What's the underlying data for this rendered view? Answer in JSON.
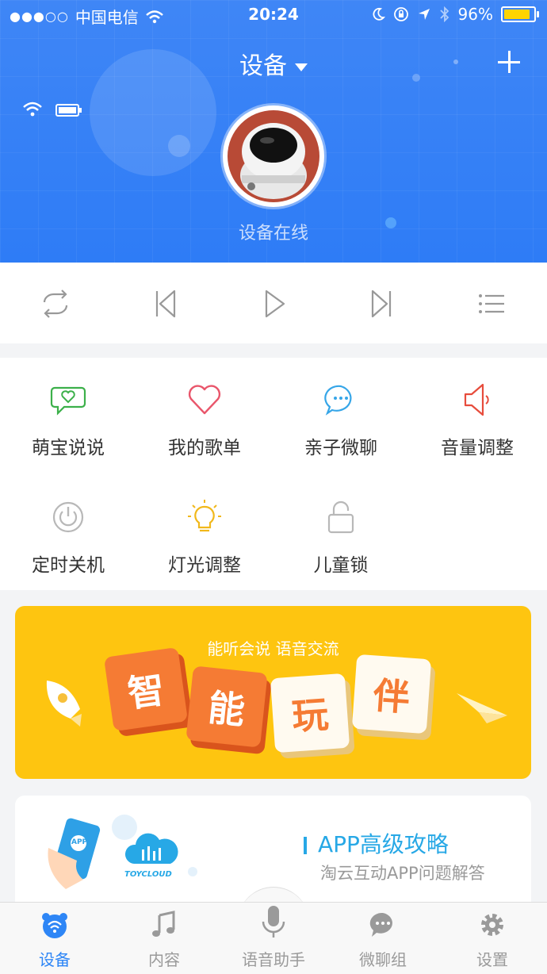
{
  "status_bar": {
    "signal_dots": "●●●○○",
    "carrier": "中国电信",
    "time": "20:24",
    "battery_percent": "96%",
    "battery_level": 0.96,
    "battery_color": "#ffd400"
  },
  "header": {
    "title": "设备",
    "status": "设备在线",
    "bg_color": "#2e7cf6"
  },
  "player": {
    "buttons": [
      "repeat-icon",
      "previous-icon",
      "play-icon",
      "next-icon",
      "playlist-icon"
    ]
  },
  "features": [
    {
      "label": "萌宝说说",
      "icon": "chat-heart-icon",
      "color": "#3cb04a"
    },
    {
      "label": "我的歌单",
      "icon": "heart-icon",
      "color": "#e9566b"
    },
    {
      "label": "亲子微聊",
      "icon": "chat-dots-icon",
      "color": "#36a6e8"
    },
    {
      "label": "音量调整",
      "icon": "speaker-icon",
      "color": "#e74c3c"
    },
    {
      "label": "定时关机",
      "icon": "power-icon",
      "color": "#b0b0b0"
    },
    {
      "label": "灯光调整",
      "icon": "bulb-icon",
      "color": "#f1b81b"
    },
    {
      "label": "儿童锁",
      "icon": "lock-icon",
      "color": "#b0b0b0"
    }
  ],
  "banner": {
    "subtitle": "能听会说   语音交流",
    "tiles": [
      "智",
      "能",
      "玩",
      "伴"
    ],
    "bg_color": "#fec510"
  },
  "app_card": {
    "title": "APP高级攻略",
    "subtitle": "淘云互动APP问题解答",
    "logo_text": "TOYCLOUD",
    "phone_text": "APP"
  },
  "tabbar": {
    "tabs": [
      {
        "label": "设备",
        "icon": "device-icon",
        "active": true
      },
      {
        "label": "内容",
        "icon": "music-note-icon",
        "active": false
      },
      {
        "label": "语音助手",
        "icon": "microphone-icon",
        "active": false
      },
      {
        "label": "微聊组",
        "icon": "chat-bubble-icon",
        "active": false
      },
      {
        "label": "设置",
        "icon": "gear-icon",
        "active": false
      }
    ],
    "active_color": "#2e86f6"
  }
}
